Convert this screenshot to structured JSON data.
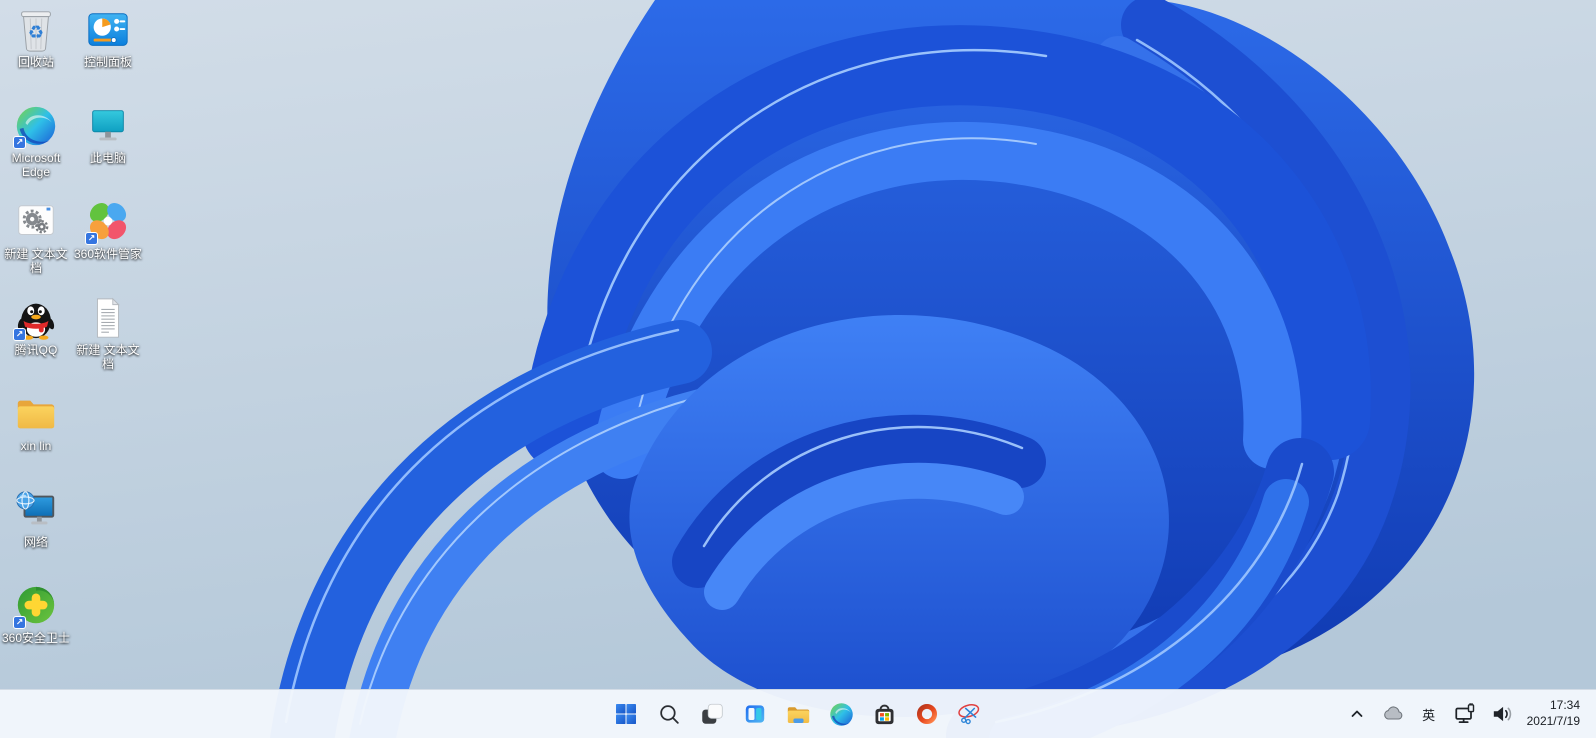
{
  "wallpaper": {
    "name": "windows-11-bloom",
    "bg_top": "#cfdbe7",
    "bg_bottom": "#b6c9da",
    "bloom_bright": "#3f80f5",
    "bloom_mid": "#2260e0",
    "bloom_deep": "#0f38b0",
    "highlight": "#9fc6ff"
  },
  "desktop": {
    "glyphs": {
      "recycle": "♻",
      "shortcut_arrow": "↗"
    },
    "icons": [
      {
        "id": "recycle-bin",
        "label": "回收站",
        "icon": "recycle-bin-icon",
        "shortcut": false
      },
      {
        "id": "control-panel",
        "label": "控制面板",
        "icon": "control-panel-icon",
        "shortcut": false
      },
      {
        "id": "microsoft-edge",
        "label": "Microsoft Edge",
        "icon": "edge-browser-icon",
        "shortcut": true
      },
      {
        "id": "this-pc",
        "label": "此电脑",
        "icon": "monitor-icon",
        "shortcut": false
      },
      {
        "id": "new-text-doc-config",
        "label": "新建 文本文档",
        "icon": "gears-file-icon",
        "shortcut": false
      },
      {
        "id": "360-software-manager",
        "label": "360软件管家",
        "icon": "pinwheel-petals-icon",
        "shortcut": true
      },
      {
        "id": "tencent-qq",
        "label": "腾讯QQ",
        "icon": "qq-penguin-icon",
        "shortcut": true
      },
      {
        "id": "new-text-doc",
        "label": "新建 文本文档",
        "icon": "text-document-icon",
        "shortcut": false
      },
      {
        "id": "xin-lin-folder",
        "label": "xin lin",
        "icon": "folder-icon",
        "shortcut": false
      },
      {
        "id": "network",
        "label": "网络",
        "icon": "network-computer-icon",
        "shortcut": false
      },
      {
        "id": "360-safety-guard",
        "label": "360安全卫士",
        "icon": "green-circle-plus-icon",
        "shortcut": true
      }
    ]
  },
  "taskbar": {
    "buttons": [
      {
        "id": "start",
        "icon": "windows-start-icon"
      },
      {
        "id": "search",
        "icon": "search-icon"
      },
      {
        "id": "task-view",
        "icon": "task-view-icon"
      },
      {
        "id": "widgets",
        "icon": "widgets-icon"
      },
      {
        "id": "file-explorer",
        "icon": "file-explorer-folder-icon"
      },
      {
        "id": "edge",
        "icon": "edge-browser-icon"
      },
      {
        "id": "microsoft-store",
        "icon": "store-bag-icon"
      },
      {
        "id": "office",
        "icon": "office-ring-icon"
      },
      {
        "id": "screen-clip",
        "icon": "scissors-ellipse-icon"
      }
    ],
    "tray": {
      "chevron": "show-hidden-icons",
      "cloud": "onedrive",
      "ime": "英",
      "network": "ethernet",
      "volume": "speaker",
      "clock": {
        "time": "17:34",
        "date": "2021/7/19"
      }
    }
  }
}
